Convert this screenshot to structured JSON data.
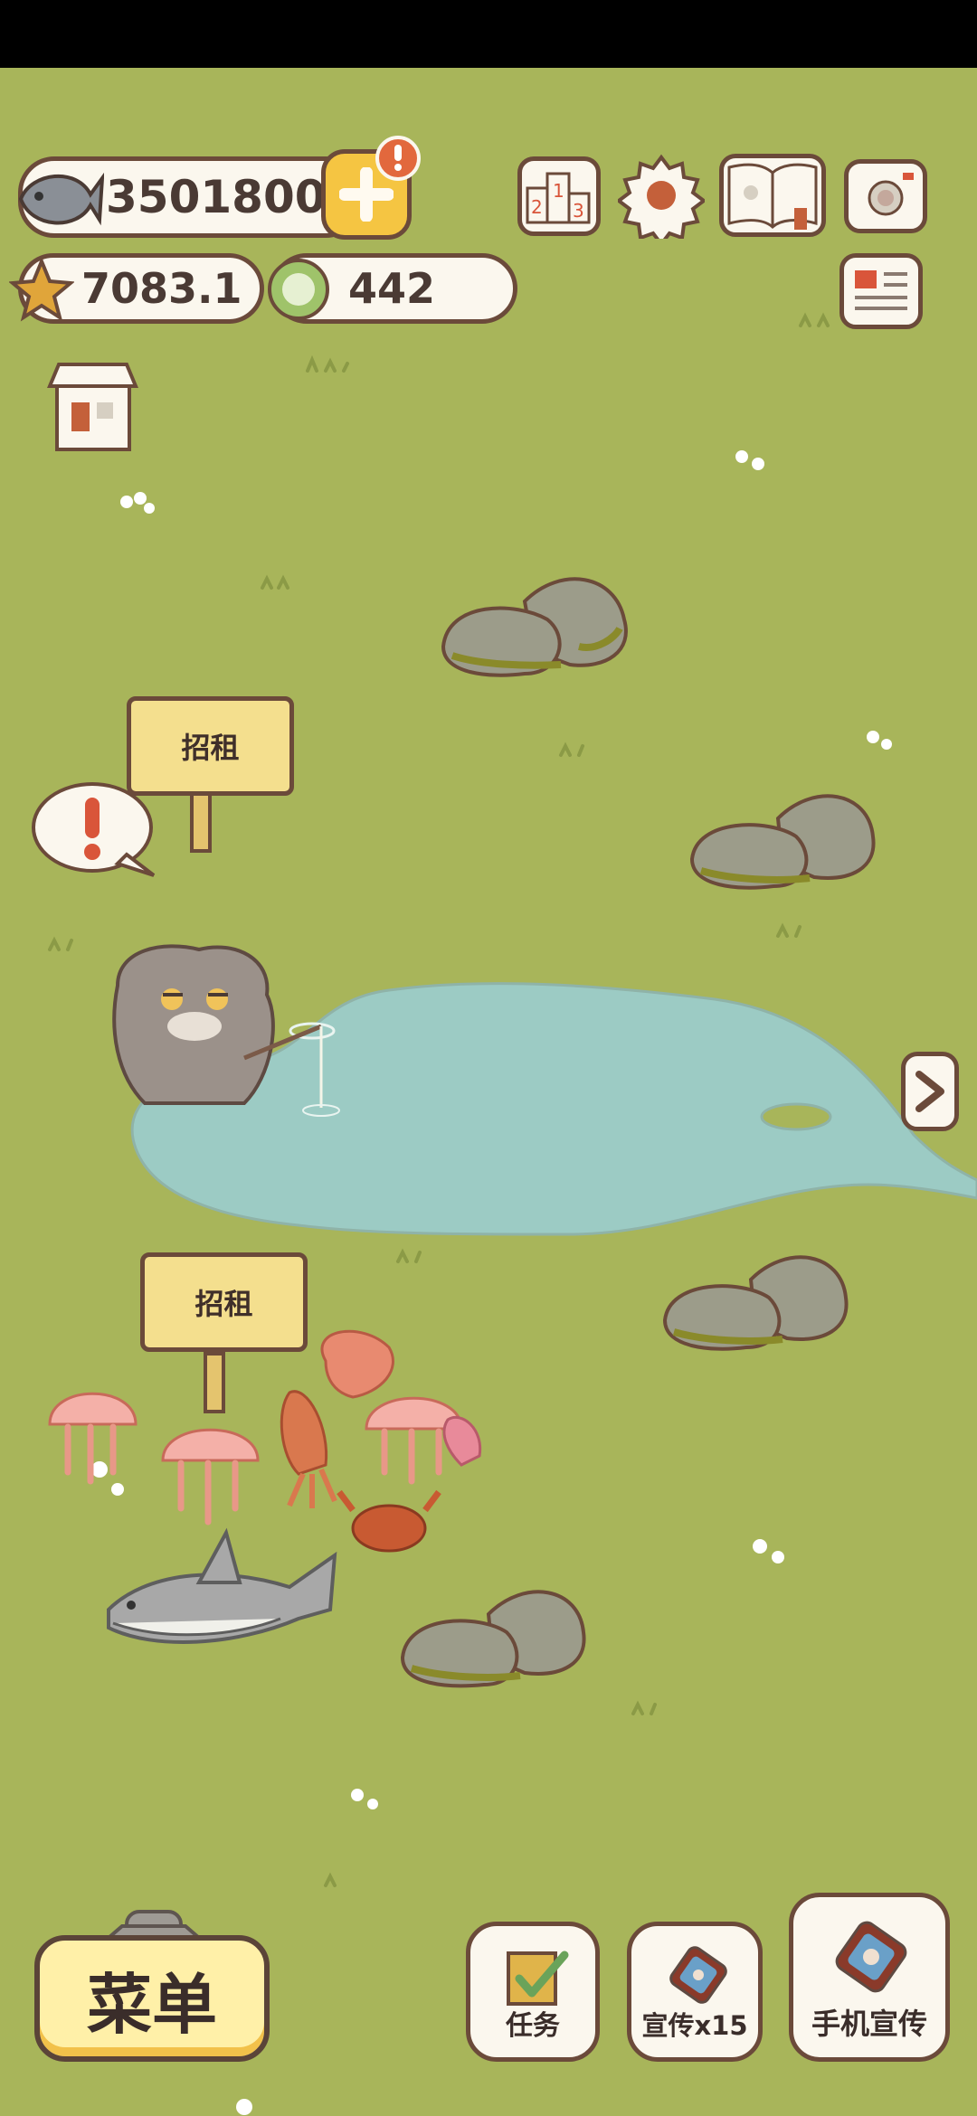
{
  "resources": {
    "fish_count": "3501800",
    "star_count": "7083.1",
    "coin_count": "442"
  },
  "signs": {
    "upper": "招租",
    "lower": "招租"
  },
  "bottom": {
    "menu_label": "菜单",
    "tasks_label": "任务",
    "promo_label": "宣传x15",
    "phone_promo_label": "手机宣传"
  },
  "colors": {
    "grass": "#a8b55a",
    "pond": "#9ccbc4",
    "outline": "#6b4a3a",
    "badge": "#e2683d",
    "menu_bg": "#fff0a8"
  },
  "icons": [
    "fish-icon",
    "plus-icon",
    "alert-icon",
    "star-icon",
    "coin-icon",
    "leaderboard-icon",
    "settings-icon",
    "book-icon",
    "camera-icon",
    "newspaper-icon",
    "shop-icon",
    "next-arrow-icon",
    "task-check-icon",
    "promo-icon",
    "phone-promo-icon"
  ]
}
